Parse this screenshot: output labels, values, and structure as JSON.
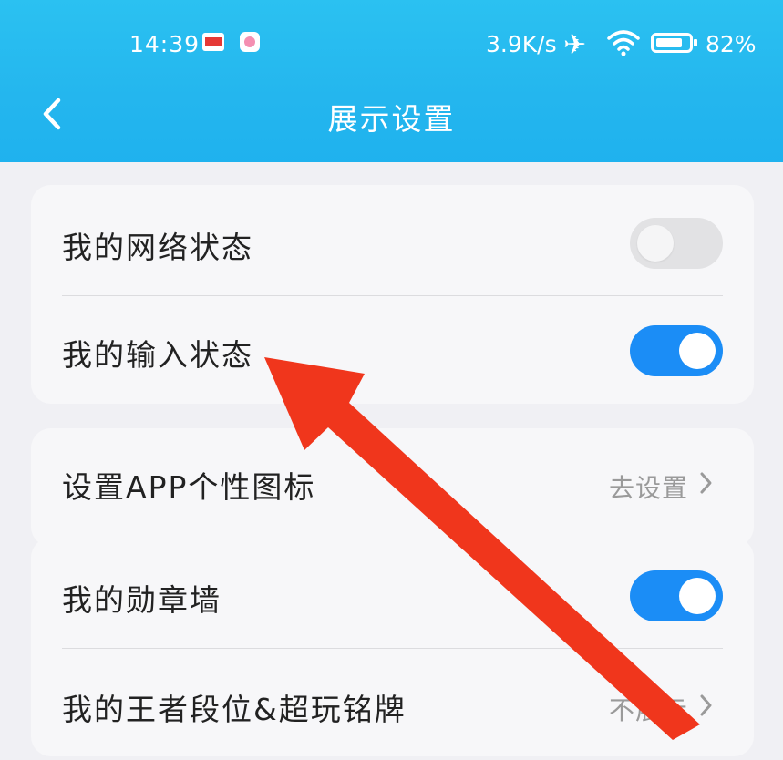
{
  "status_bar": {
    "time": "14:39",
    "network_speed": "3.9K/s",
    "battery_percent": "82%",
    "battery_level": 0.82,
    "icons": [
      "notification-app-icon",
      "notification-avatar-icon",
      "airplane-mode-icon",
      "wifi-icon",
      "battery-icon"
    ]
  },
  "header": {
    "title": "展示设置",
    "back_icon": "chevron-left-icon"
  },
  "settings": {
    "network_status": {
      "label": "我的网络状态",
      "enabled": false
    },
    "input_status": {
      "label": "我的输入状态",
      "enabled": true
    },
    "app_icon": {
      "label": "设置APP个性图标",
      "action": "去设置"
    },
    "badge_wall": {
      "label": "我的勋章墙",
      "enabled": true
    },
    "rank_badge": {
      "label": "我的王者段位&超玩铭牌",
      "action": "不展示"
    }
  },
  "colors": {
    "header_blue": "#24b6ee",
    "toggle_on": "#1b8df6",
    "toggle_off": "#e2e2e4",
    "annotation_arrow": "#f0361c"
  }
}
